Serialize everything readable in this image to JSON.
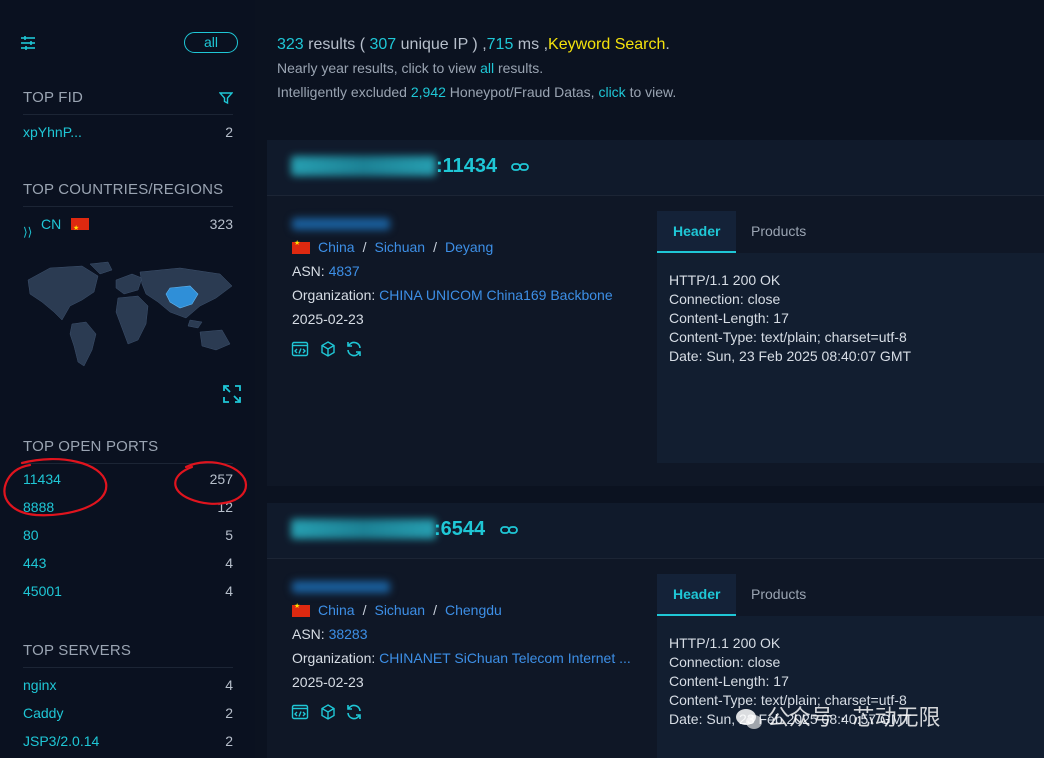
{
  "sidebar": {
    "all_label": "all",
    "top_fid": {
      "title": "TOP FID",
      "items": [
        {
          "key": "xpYhnP...",
          "count": "2"
        }
      ]
    },
    "top_countries": {
      "title": "TOP COUNTRIES/REGIONS",
      "items": [
        {
          "key": "CN",
          "count": "323"
        }
      ]
    },
    "top_ports": {
      "title": "TOP OPEN PORTS",
      "items": [
        {
          "key": "11434",
          "count": "257"
        },
        {
          "key": "8888",
          "count": "12"
        },
        {
          "key": "80",
          "count": "5"
        },
        {
          "key": "443",
          "count": "4"
        },
        {
          "key": "45001",
          "count": "4"
        }
      ]
    },
    "top_servers": {
      "title": "TOP SERVERS",
      "items": [
        {
          "key": "nginx",
          "count": "4"
        },
        {
          "key": "Caddy",
          "count": "2"
        },
        {
          "key": "JSP3/2.0.14",
          "count": "2"
        }
      ]
    }
  },
  "summary": {
    "count": "323",
    "results_word": " results ( ",
    "unique": "307",
    "unique_word": " unique IP ) ,",
    "ms": "715",
    "ms_word": " ms ,",
    "keyword": "Keyword Search",
    "dot": ".",
    "line2_pre": "Nearly year results, click to view ",
    "line2_link": "all",
    "line2_post": " results.",
    "line3_pre": "Intelligently excluded ",
    "line3_num": "2,942",
    "line3_mid": " Honeypot/Fraud Datas, ",
    "line3_link": "click",
    "line3_post": " to view."
  },
  "results": [
    {
      "port": ":11434",
      "country": "China",
      "region": "Sichuan",
      "city": "Deyang",
      "asn_label": "ASN: ",
      "asn": "4837",
      "org_label": "Organization: ",
      "org": "CHINA UNICOM China169 Backbone",
      "date": "2025-02-23",
      "tab_header": "Header",
      "tab_products": "Products",
      "header_lines": [
        "HTTP/1.1 200 OK",
        "Connection: close",
        "Content-Length: 17",
        "Content-Type: text/plain; charset=utf-8",
        "Date: Sun, 23 Feb 2025 08:40:07 GMT"
      ]
    },
    {
      "port": ":6544",
      "country": "China",
      "region": "Sichuan",
      "city": "Chengdu",
      "asn_label": "ASN: ",
      "asn": "38283",
      "org_label": "Organization: ",
      "org": "CHINANET SiChuan Telecom Internet ...",
      "date": "2025-02-23",
      "tab_header": "Header",
      "tab_products": "Products",
      "header_lines": [
        "HTTP/1.1 200 OK",
        "Connection: close",
        "Content-Length: 17",
        "Content-Type: text/plain; charset=utf-8",
        "Date: Sun, 23 Feb 2025 08:40:57 GMT"
      ]
    }
  ],
  "watermark": "公众号 · 芯动无限",
  "colors": {
    "accent": "#1fc7d6",
    "link": "#3d8fe6",
    "keyword": "#f4e20c",
    "annotation": "#e0141e"
  }
}
